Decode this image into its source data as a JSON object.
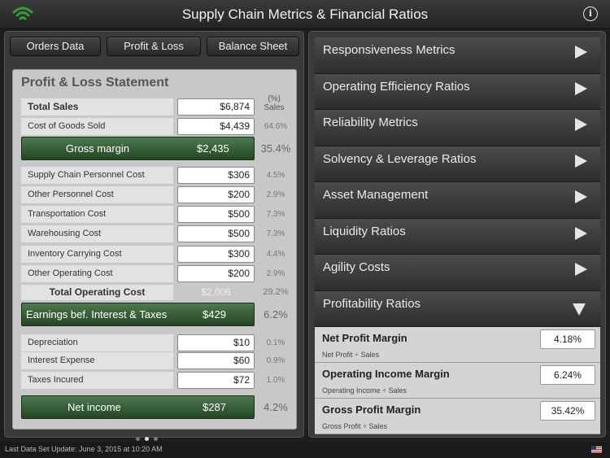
{
  "app": {
    "title": "Supply Chain Metrics & Financial Ratios"
  },
  "tabs": [
    {
      "label": "Orders Data"
    },
    {
      "label": "Profit & Loss"
    },
    {
      "label": "Balance Sheet"
    }
  ],
  "statement": {
    "title": "Profit & Loss Statement",
    "sales_header": "(%) Sales",
    "total_sales": {
      "label": "Total Sales",
      "value": "$6,874"
    },
    "cogs": {
      "label": "Cost of Goods Sold",
      "value": "$4,439",
      "pct": "64.6%"
    },
    "gross_margin": {
      "label": "Gross margin",
      "value": "$2,435",
      "pct": "35.4%"
    },
    "costs": [
      {
        "label": "Supply Chain Personnel Cost",
        "value": "$306",
        "pct": "4.5%"
      },
      {
        "label": "Other Personnel Cost",
        "value": "$200",
        "pct": "2.9%"
      },
      {
        "label": "Transportation Cost",
        "value": "$500",
        "pct": "7.3%"
      },
      {
        "label": "Warehousing Cost",
        "value": "$500",
        "pct": "7.3%"
      },
      {
        "label": "Inventory Carrying Cost",
        "value": "$300",
        "pct": "4.4%"
      },
      {
        "label": "Other Operating Cost",
        "value": "$200",
        "pct": "2.9%"
      }
    ],
    "total_operating": {
      "label": "Total Operating Cost",
      "value": "$2,006",
      "pct": "29.2%"
    },
    "ebit": {
      "label": "Earnings bef. Interest & Taxes",
      "value": "$429",
      "pct": "6.2%"
    },
    "other": [
      {
        "label": "Depreciation",
        "value": "$10",
        "pct": "0.1%"
      },
      {
        "label": "Interest Expense",
        "value": "$60",
        "pct": "0.9%"
      },
      {
        "label": "Taxes Incured",
        "value": "$72",
        "pct": "1.0%"
      }
    ],
    "net_income": {
      "label": "Net income",
      "value": "$287",
      "pct": "4.2%"
    }
  },
  "menu": [
    {
      "label": "Responsiveness Metrics"
    },
    {
      "label": "Operating Efficiency Ratios"
    },
    {
      "label": "Reliability Metrics"
    },
    {
      "label": "Solvency & Leverage Ratios"
    },
    {
      "label": "Asset Management"
    },
    {
      "label": "Liquidity Ratios"
    },
    {
      "label": "Agility Costs"
    },
    {
      "label": "Profitability Ratios"
    }
  ],
  "profitability": [
    {
      "name": "Net Profit Margin",
      "formula": "Net Profit ÷ Sales",
      "value": "4.18%"
    },
    {
      "name": "Operating Income Margin",
      "formula": "Operating Income ÷ Sales",
      "value": "6.24%"
    },
    {
      "name": "Gross Profit Margin",
      "formula": "Gross Profit ÷ Sales",
      "value": "35.42%"
    }
  ],
  "status": {
    "text": "Last Data Set Update:  June 3, 2015 at 10:20 AM"
  },
  "colors": {
    "accent_green": "#3a9a3a",
    "bar_green": "#2f5a2f"
  }
}
